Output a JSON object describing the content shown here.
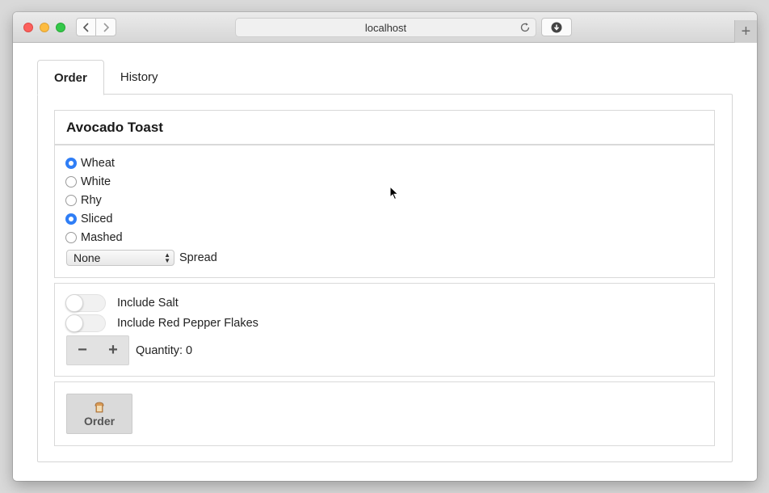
{
  "browser": {
    "url": "localhost",
    "icons": {
      "back": "chevron-left-icon",
      "forward": "chevron-right-icon",
      "reload": "reload-icon",
      "download": "download-icon",
      "new_tab": "plus-icon"
    },
    "new_tab_label": "+"
  },
  "tabs": [
    {
      "label": "Order",
      "active": true
    },
    {
      "label": "History",
      "active": false
    }
  ],
  "product": {
    "title": "Avocado Toast",
    "radios": [
      {
        "label": "Wheat",
        "checked": true
      },
      {
        "label": "White",
        "checked": false
      },
      {
        "label": "Rhy",
        "checked": false
      },
      {
        "label": "Sliced",
        "checked": true
      },
      {
        "label": "Mashed",
        "checked": false
      }
    ],
    "spread_select": {
      "value": "None",
      "label": "Spread"
    }
  },
  "options": {
    "toggles": [
      {
        "label": "Include Salt",
        "on": false
      },
      {
        "label": "Include Red Pepper Flakes",
        "on": false
      }
    ],
    "stepper": {
      "minus": "−",
      "plus": "+",
      "quantity_label": "Quantity: 0"
    }
  },
  "order_button": {
    "label": "Order",
    "icon": "bread-icon"
  },
  "colors": {
    "accent": "#2f7ef6"
  }
}
